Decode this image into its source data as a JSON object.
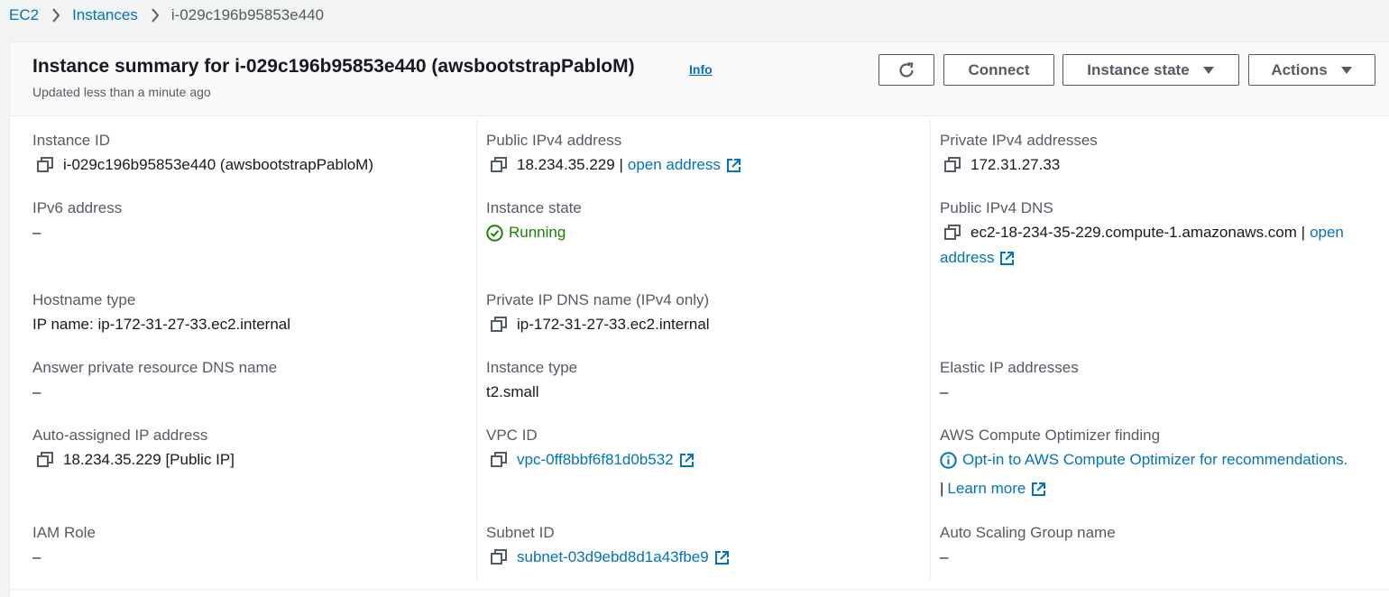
{
  "breadcrumb": {
    "ec2": "EC2",
    "instances": "Instances",
    "current": "i-029c196b95853e440"
  },
  "header": {
    "title": "Instance summary for i-029c196b95853e440 (awsbootstrapPabloM)",
    "info": "Info",
    "subtitle": "Updated less than a minute ago",
    "buttons": {
      "connect": "Connect",
      "instance_state": "Instance state",
      "actions": "Actions"
    }
  },
  "fields": {
    "instance_id": {
      "label": "Instance ID",
      "value": "i-029c196b95853e440 (awsbootstrapPabloM)"
    },
    "public_ipv4": {
      "label": "Public IPv4 address",
      "value": "18.234.35.229 |",
      "link": "open address"
    },
    "private_ipv4": {
      "label": "Private IPv4 addresses",
      "value": "172.31.27.33"
    },
    "ipv6": {
      "label": "IPv6 address",
      "value": "–"
    },
    "instance_state": {
      "label": "Instance state",
      "value": "Running"
    },
    "public_dns": {
      "label": "Public IPv4 DNS",
      "value": "ec2-18-234-35-229.compute-1.amazonaws.com |",
      "link_part1": "open",
      "link_part2": "address"
    },
    "hostname_type": {
      "label": "Hostname type",
      "value": "IP name: ip-172-31-27-33.ec2.internal"
    },
    "private_dns": {
      "label": "Private IP DNS name (IPv4 only)",
      "value": "ip-172-31-27-33.ec2.internal"
    },
    "answer_dns": {
      "label": "Answer private resource DNS name",
      "value": "–"
    },
    "instance_type": {
      "label": "Instance type",
      "value": "t2.small"
    },
    "elastic_ip": {
      "label": "Elastic IP addresses",
      "value": "–"
    },
    "auto_ip": {
      "label": "Auto-assigned IP address",
      "value": "18.234.35.229 [Public IP]"
    },
    "vpc_id": {
      "label": "VPC ID",
      "value": "vpc-0ff8bbf6f81d0b532"
    },
    "optimizer": {
      "label": "AWS Compute Optimizer finding",
      "link": "Opt-in to AWS Compute Optimizer for recommendations.",
      "sep": "|",
      "learn_more": "Learn more"
    },
    "iam_role": {
      "label": "IAM Role",
      "value": "–"
    },
    "subnet_id": {
      "label": "Subnet ID",
      "value": "subnet-03d9ebd8d1a43fbe9"
    },
    "asg_name": {
      "label": "Auto Scaling Group name",
      "value": "–"
    }
  },
  "colors": {
    "link": "#0073bb",
    "running": "#1d8102",
    "label": "#545b64",
    "text": "#16191f"
  },
  "icons": [
    "chevron-right-icon",
    "refresh-icon",
    "caret-down-icon",
    "copy-icon",
    "external-link-icon",
    "check-circle-icon",
    "info-circle-icon"
  ]
}
